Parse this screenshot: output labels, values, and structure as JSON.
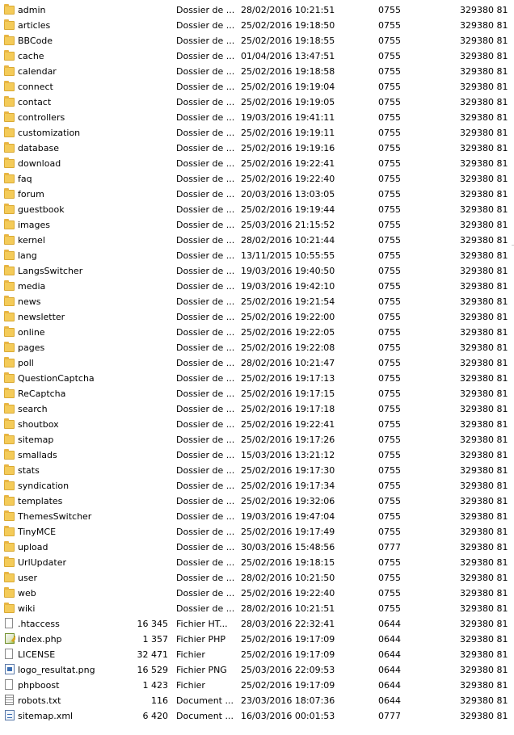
{
  "files": [
    {
      "name": "admin",
      "size": "",
      "type": "Dossier de ...",
      "modified": "28/02/2016 10:21:51",
      "permissions": "0755",
      "owner": "329380 81",
      "icon": "folder-icon"
    },
    {
      "name": "articles",
      "size": "",
      "type": "Dossier de ...",
      "modified": "25/02/2016 19:18:50",
      "permissions": "0755",
      "owner": "329380 81",
      "icon": "folder-icon"
    },
    {
      "name": "BBCode",
      "size": "",
      "type": "Dossier de ...",
      "modified": "25/02/2016 19:18:55",
      "permissions": "0755",
      "owner": "329380 81",
      "icon": "folder-icon"
    },
    {
      "name": "cache",
      "size": "",
      "type": "Dossier de ...",
      "modified": "01/04/2016 13:47:51",
      "permissions": "0755",
      "owner": "329380 81",
      "icon": "folder-icon"
    },
    {
      "name": "calendar",
      "size": "",
      "type": "Dossier de ...",
      "modified": "25/02/2016 19:18:58",
      "permissions": "0755",
      "owner": "329380 81",
      "icon": "folder-icon"
    },
    {
      "name": "connect",
      "size": "",
      "type": "Dossier de ...",
      "modified": "25/02/2016 19:19:04",
      "permissions": "0755",
      "owner": "329380 81",
      "icon": "folder-icon"
    },
    {
      "name": "contact",
      "size": "",
      "type": "Dossier de ...",
      "modified": "25/02/2016 19:19:05",
      "permissions": "0755",
      "owner": "329380 81",
      "icon": "folder-icon"
    },
    {
      "name": "controllers",
      "size": "",
      "type": "Dossier de ...",
      "modified": "19/03/2016 19:41:11",
      "permissions": "0755",
      "owner": "329380 81",
      "icon": "folder-icon"
    },
    {
      "name": "customization",
      "size": "",
      "type": "Dossier de ...",
      "modified": "25/02/2016 19:19:11",
      "permissions": "0755",
      "owner": "329380 81",
      "icon": "folder-icon"
    },
    {
      "name": "database",
      "size": "",
      "type": "Dossier de ...",
      "modified": "25/02/2016 19:19:16",
      "permissions": "0755",
      "owner": "329380 81",
      "icon": "folder-icon"
    },
    {
      "name": "download",
      "size": "",
      "type": "Dossier de ...",
      "modified": "25/02/2016 19:22:41",
      "permissions": "0755",
      "owner": "329380 81",
      "icon": "folder-icon"
    },
    {
      "name": "faq",
      "size": "",
      "type": "Dossier de ...",
      "modified": "25/02/2016 19:22:40",
      "permissions": "0755",
      "owner": "329380 81",
      "icon": "folder-icon"
    },
    {
      "name": "forum",
      "size": "",
      "type": "Dossier de ...",
      "modified": "20/03/2016 13:03:05",
      "permissions": "0755",
      "owner": "329380 81",
      "icon": "folder-icon"
    },
    {
      "name": "guestbook",
      "size": "",
      "type": "Dossier de ...",
      "modified": "25/02/2016 19:19:44",
      "permissions": "0755",
      "owner": "329380 81",
      "icon": "folder-icon"
    },
    {
      "name": "images",
      "size": "",
      "type": "Dossier de ...",
      "modified": "25/03/2016 21:15:52",
      "permissions": "0755",
      "owner": "329380 81",
      "icon": "folder-icon"
    },
    {
      "name": "kernel",
      "size": "",
      "type": "Dossier de ...",
      "modified": "28/02/2016 10:21:44",
      "permissions": "0755",
      "owner": "329380 81",
      "icon": "folder-icon"
    },
    {
      "name": "lang",
      "size": "",
      "type": "Dossier de ...",
      "modified": "13/11/2015 10:55:55",
      "permissions": "0755",
      "owner": "329380 81",
      "icon": "folder-icon"
    },
    {
      "name": "LangsSwitcher",
      "size": "",
      "type": "Dossier de ...",
      "modified": "19/03/2016 19:40:50",
      "permissions": "0755",
      "owner": "329380 81",
      "icon": "folder-icon"
    },
    {
      "name": "media",
      "size": "",
      "type": "Dossier de ...",
      "modified": "19/03/2016 19:42:10",
      "permissions": "0755",
      "owner": "329380 81",
      "icon": "folder-icon"
    },
    {
      "name": "news",
      "size": "",
      "type": "Dossier de ...",
      "modified": "25/02/2016 19:21:54",
      "permissions": "0755",
      "owner": "329380 81",
      "icon": "folder-icon"
    },
    {
      "name": "newsletter",
      "size": "",
      "type": "Dossier de ...",
      "modified": "25/02/2016 19:22:00",
      "permissions": "0755",
      "owner": "329380 81",
      "icon": "folder-icon"
    },
    {
      "name": "online",
      "size": "",
      "type": "Dossier de ...",
      "modified": "25/02/2016 19:22:05",
      "permissions": "0755",
      "owner": "329380 81",
      "icon": "folder-icon"
    },
    {
      "name": "pages",
      "size": "",
      "type": "Dossier de ...",
      "modified": "25/02/2016 19:22:08",
      "permissions": "0755",
      "owner": "329380 81",
      "icon": "folder-icon"
    },
    {
      "name": "poll",
      "size": "",
      "type": "Dossier de ...",
      "modified": "28/02/2016 10:21:47",
      "permissions": "0755",
      "owner": "329380 81",
      "icon": "folder-icon"
    },
    {
      "name": "QuestionCaptcha",
      "size": "",
      "type": "Dossier de ...",
      "modified": "25/02/2016 19:17:13",
      "permissions": "0755",
      "owner": "329380 81",
      "icon": "folder-icon"
    },
    {
      "name": "ReCaptcha",
      "size": "",
      "type": "Dossier de ...",
      "modified": "25/02/2016 19:17:15",
      "permissions": "0755",
      "owner": "329380 81",
      "icon": "folder-icon"
    },
    {
      "name": "search",
      "size": "",
      "type": "Dossier de ...",
      "modified": "25/02/2016 19:17:18",
      "permissions": "0755",
      "owner": "329380 81",
      "icon": "folder-icon"
    },
    {
      "name": "shoutbox",
      "size": "",
      "type": "Dossier de ...",
      "modified": "25/02/2016 19:22:41",
      "permissions": "0755",
      "owner": "329380 81",
      "icon": "folder-icon"
    },
    {
      "name": "sitemap",
      "size": "",
      "type": "Dossier de ...",
      "modified": "25/02/2016 19:17:26",
      "permissions": "0755",
      "owner": "329380 81",
      "icon": "folder-icon"
    },
    {
      "name": "smallads",
      "size": "",
      "type": "Dossier de ...",
      "modified": "15/03/2016 13:21:12",
      "permissions": "0755",
      "owner": "329380 81",
      "icon": "folder-icon"
    },
    {
      "name": "stats",
      "size": "",
      "type": "Dossier de ...",
      "modified": "25/02/2016 19:17:30",
      "permissions": "0755",
      "owner": "329380 81",
      "icon": "folder-icon"
    },
    {
      "name": "syndication",
      "size": "",
      "type": "Dossier de ...",
      "modified": "25/02/2016 19:17:34",
      "permissions": "0755",
      "owner": "329380 81",
      "icon": "folder-icon"
    },
    {
      "name": "templates",
      "size": "",
      "type": "Dossier de ...",
      "modified": "25/02/2016 19:32:06",
      "permissions": "0755",
      "owner": "329380 81",
      "icon": "folder-icon"
    },
    {
      "name": "ThemesSwitcher",
      "size": "",
      "type": "Dossier de ...",
      "modified": "19/03/2016 19:47:04",
      "permissions": "0755",
      "owner": "329380 81",
      "icon": "folder-icon"
    },
    {
      "name": "TinyMCE",
      "size": "",
      "type": "Dossier de ...",
      "modified": "25/02/2016 19:17:49",
      "permissions": "0755",
      "owner": "329380 81",
      "icon": "folder-icon"
    },
    {
      "name": "upload",
      "size": "",
      "type": "Dossier de ...",
      "modified": "30/03/2016 15:48:56",
      "permissions": "0777",
      "owner": "329380 81",
      "icon": "folder-icon"
    },
    {
      "name": "UrlUpdater",
      "size": "",
      "type": "Dossier de ...",
      "modified": "25/02/2016 19:18:15",
      "permissions": "0755",
      "owner": "329380 81",
      "icon": "folder-icon"
    },
    {
      "name": "user",
      "size": "",
      "type": "Dossier de ...",
      "modified": "28/02/2016 10:21:50",
      "permissions": "0755",
      "owner": "329380 81",
      "icon": "folder-icon"
    },
    {
      "name": "web",
      "size": "",
      "type": "Dossier de ...",
      "modified": "25/02/2016 19:22:40",
      "permissions": "0755",
      "owner": "329380 81",
      "icon": "folder-icon"
    },
    {
      "name": "wiki",
      "size": "",
      "type": "Dossier de ...",
      "modified": "28/02/2016 10:21:51",
      "permissions": "0755",
      "owner": "329380 81",
      "icon": "folder-icon"
    },
    {
      "name": ".htaccess",
      "size": "16 345",
      "type": "Fichier HT...",
      "modified": "28/03/2016 22:32:41",
      "permissions": "0644",
      "owner": "329380 81",
      "icon": "file-icon"
    },
    {
      "name": "index.php",
      "size": "1 357",
      "type": "Fichier PHP",
      "modified": "25/02/2016 19:17:09",
      "permissions": "0644",
      "owner": "329380 81",
      "icon": "php-file-icon"
    },
    {
      "name": "LICENSE",
      "size": "32 471",
      "type": "Fichier",
      "modified": "25/02/2016 19:17:09",
      "permissions": "0644",
      "owner": "329380 81",
      "icon": "file-icon"
    },
    {
      "name": "logo_resultat.png",
      "size": "16 529",
      "type": "Fichier PNG",
      "modified": "25/03/2016 22:09:53",
      "permissions": "0644",
      "owner": "329380 81",
      "icon": "image-file-icon"
    },
    {
      "name": "phpboost",
      "size": "1 423",
      "type": "Fichier",
      "modified": "25/02/2016 19:17:09",
      "permissions": "0644",
      "owner": "329380 81",
      "icon": "file-icon"
    },
    {
      "name": "robots.txt",
      "size": "116",
      "type": "Document ...",
      "modified": "23/03/2016 18:07:36",
      "permissions": "0644",
      "owner": "329380 81",
      "icon": "text-file-icon"
    },
    {
      "name": "sitemap.xml",
      "size": "6 420",
      "type": "Document ...",
      "modified": "16/03/2016 00:01:53",
      "permissions": "0777",
      "owner": "329380 81",
      "icon": "xml-file-icon"
    }
  ]
}
